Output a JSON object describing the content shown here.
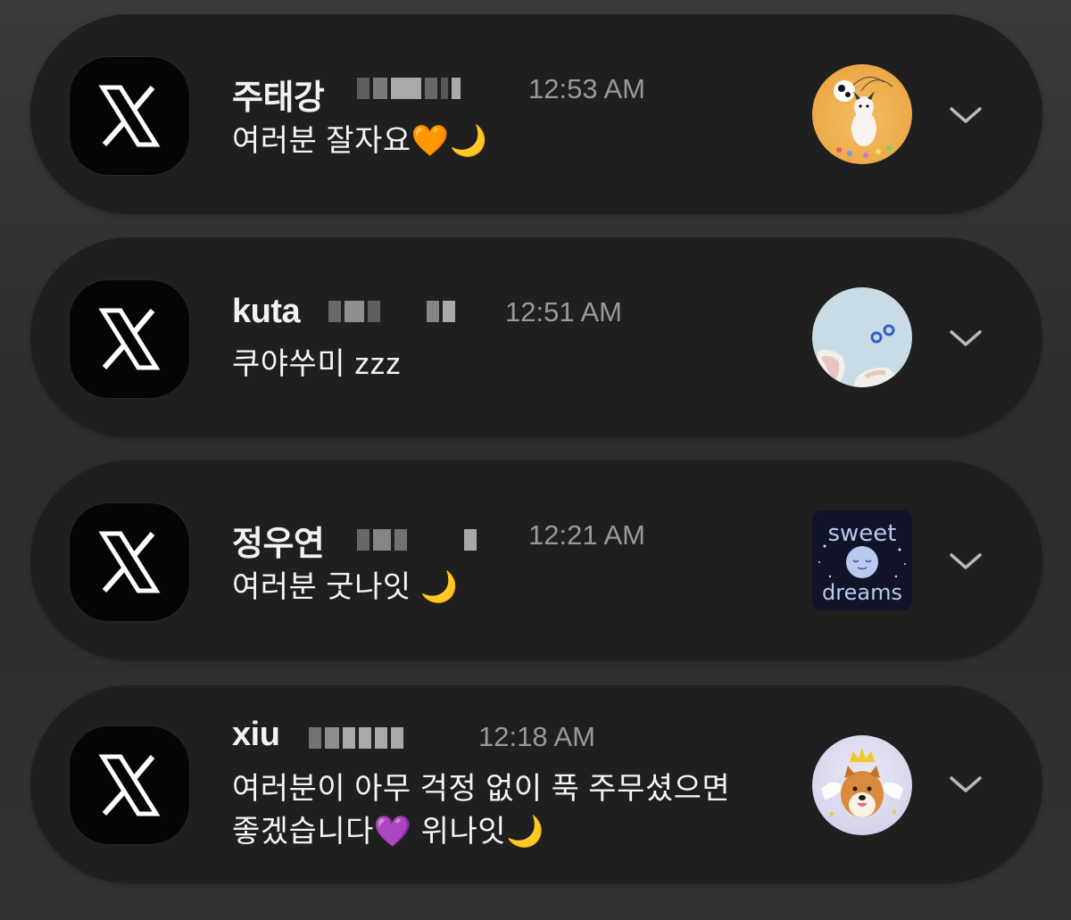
{
  "notifications": [
    {
      "sender": "주태강",
      "time": "12:53 AM",
      "message_lines": [
        "여러분 잘자요🧡🌙"
      ],
      "app_icon": "x-logo-icon",
      "avatar": "dog-with-balloons-avatar"
    },
    {
      "sender": "kuta",
      "time": "12:51 AM",
      "message_lines": [
        "쿠야쑤미 zzz"
      ],
      "app_icon": "x-logo-icon",
      "avatar": "bunny-ears-avatar"
    },
    {
      "sender": "정우연",
      "time": "12:21 AM",
      "message_lines": [
        "여러분 굿나잇 🌙"
      ],
      "app_icon": "x-logo-icon",
      "avatar": "sweet-dreams-avatar",
      "avatar_text": [
        "sweet",
        "dreams"
      ]
    },
    {
      "sender": "xiu",
      "time": "12:18 AM",
      "message_lines": [
        "여러분이 아무 걱정 없이 푹 주무셨으면",
        "좋겠습니다💜 위나잇🌙"
      ],
      "app_icon": "x-logo-icon",
      "avatar": "shiba-with-crown-avatar"
    }
  ],
  "colors": {
    "card_background": "#1f1f20",
    "app_icon_background": "#050505",
    "sender_text": "#f2f2f2",
    "time_text": "#9a9a9c",
    "message_text": "#f4f4f4"
  }
}
